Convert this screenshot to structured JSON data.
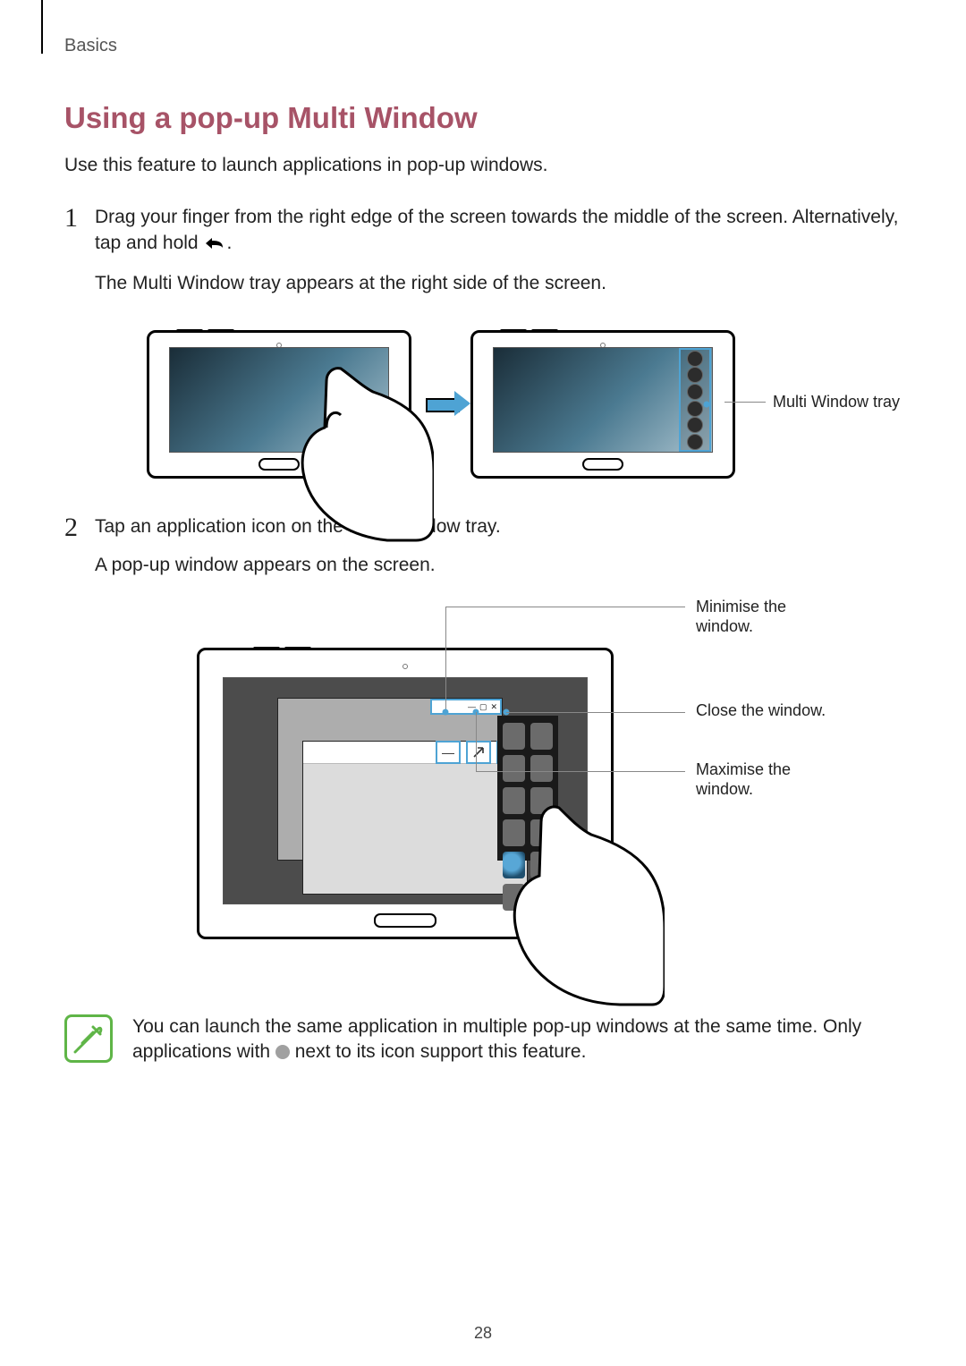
{
  "page": {
    "breadcrumb": "Basics",
    "number": "28"
  },
  "section": {
    "title": "Using a pop-up Multi Window",
    "intro": "Use this feature to launch applications in pop-up windows."
  },
  "steps": [
    {
      "num": "1",
      "line1_a": "Drag your finger from the right edge of the screen towards the middle of the screen. Alternatively, tap and hold ",
      "line1_b": ".",
      "line2": "The Multi Window tray appears at the right side of the screen."
    },
    {
      "num": "2",
      "line1": "Tap an application icon on the Multi Window tray.",
      "line2": "A pop-up window appears on the screen."
    }
  ],
  "callouts": {
    "multi_window_tray": "Multi Window tray",
    "minimise": "Minimise the window.",
    "close": "Close the window.",
    "maximise": "Maximise the window."
  },
  "note": {
    "text_a": "You can launch the same application in multiple pop-up windows at the same time. Only applications with ",
    "text_b": " next to its icon support this feature."
  }
}
